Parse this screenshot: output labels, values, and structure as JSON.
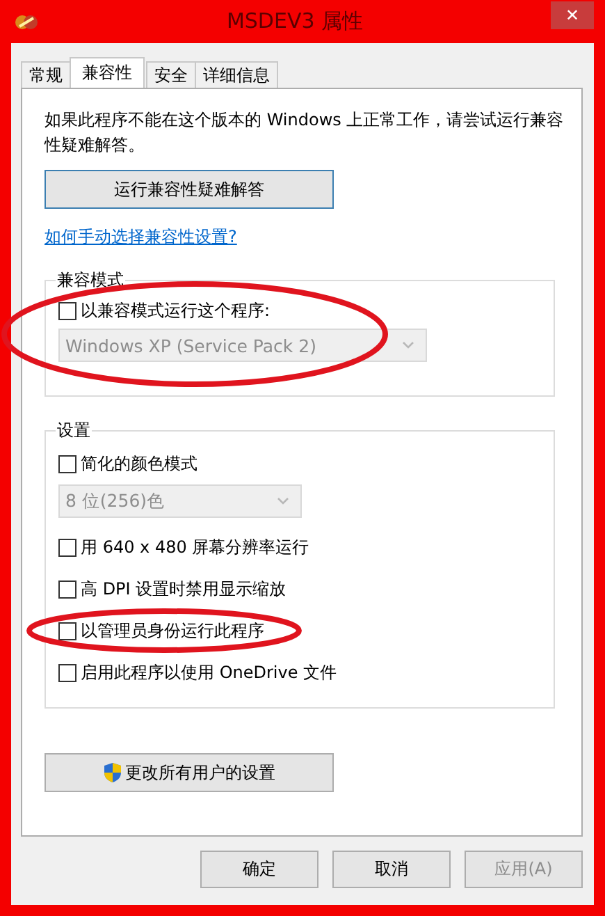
{
  "window": {
    "title": "MSDEV3 属性",
    "close": "✕"
  },
  "tabs": [
    {
      "label": "常规",
      "selected": false
    },
    {
      "label": "兼容性",
      "selected": true
    },
    {
      "label": "安全",
      "selected": false
    },
    {
      "label": "详细信息",
      "selected": false
    }
  ],
  "description": "如果此程序不能在这个版本的 Windows 上正常工作，请尝试运行兼容性疑难解答。",
  "troubleshoot_button": "运行兼容性疑难解答",
  "help_link": "如何手动选择兼容性设置?",
  "compat_mode": {
    "title": "兼容模式",
    "circled": true,
    "checkbox": {
      "label": "以兼容模式运行这个程序:",
      "checked": false
    },
    "dropdown": {
      "value": "Windows XP (Service Pack 2)",
      "disabled": true
    }
  },
  "settings": {
    "title": "设置",
    "items": [
      {
        "kind": "checkbox",
        "label": "简化的颜色模式",
        "checked": false,
        "circled": false
      },
      {
        "kind": "dropdown",
        "value": "8 位(256)色",
        "disabled": true
      },
      {
        "kind": "checkbox",
        "label": "用 640 x 480 屏幕分辨率运行",
        "checked": false,
        "circled": false
      },
      {
        "kind": "checkbox",
        "label": "高 DPI 设置时禁用显示缩放",
        "checked": false,
        "circled": false
      },
      {
        "kind": "checkbox",
        "label": "以管理员身份运行此程序",
        "checked": false,
        "circled": true
      },
      {
        "kind": "checkbox",
        "label": "启用此程序以使用 OneDrive 文件",
        "checked": false,
        "circled": false
      }
    ]
  },
  "all_users_button": "更改所有用户的设置",
  "buttons": [
    {
      "label": "确定",
      "disabled": false
    },
    {
      "label": "取消",
      "disabled": false
    },
    {
      "label": "应用(A)",
      "disabled": true
    }
  ]
}
